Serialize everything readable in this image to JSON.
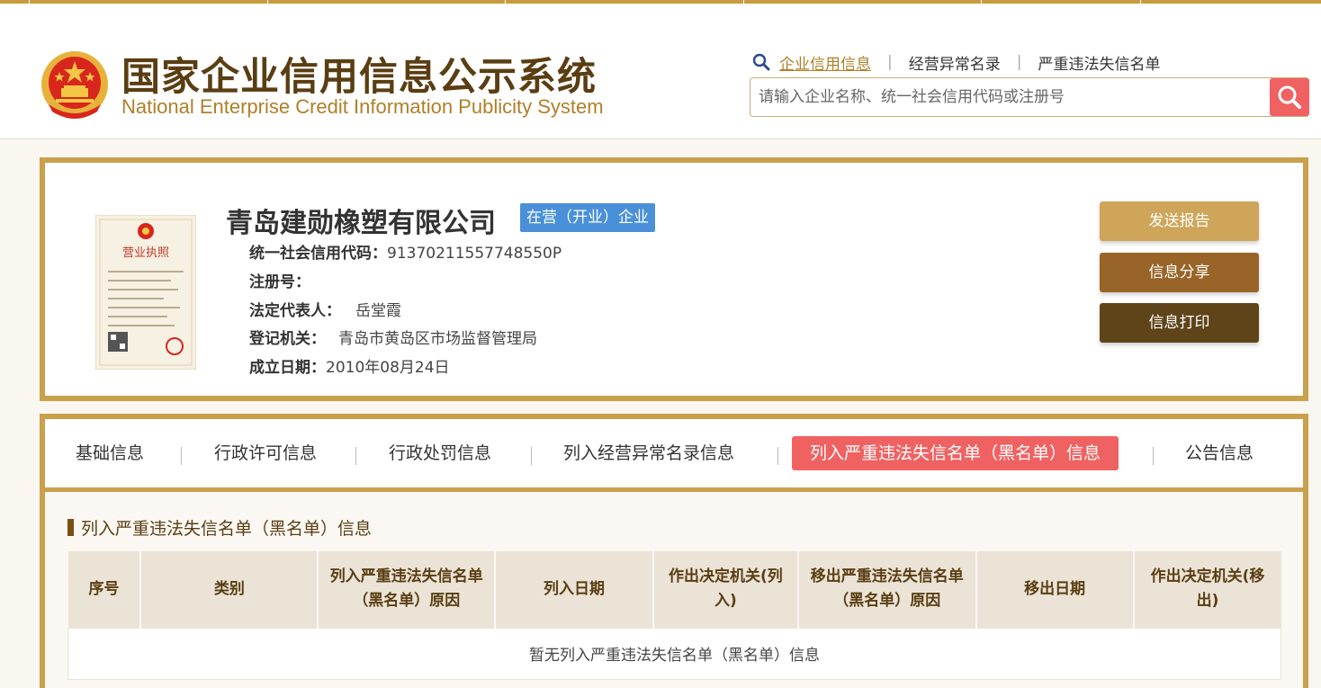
{
  "header": {
    "title_cn": "国家企业信用信息公示系统",
    "title_en": "National Enterprise Credit Information Publicity System",
    "search_links": [
      "企业信用信息",
      "经营异常名录",
      "严重违法失信名单"
    ],
    "search_placeholder": "请输入企业名称、统一社会信用代码或注册号",
    "icons": [
      "emblem-icon",
      "search-icon"
    ]
  },
  "company": {
    "name": "青岛建勋橡塑有限公司",
    "status": "在营（开业）企业",
    "fields": [
      {
        "label": "统一社会信用代码：",
        "value": "91370211557748550P"
      },
      {
        "label": "注册号：",
        "value": ""
      },
      {
        "label": "法定代表人：",
        "value": "岳堂霞"
      },
      {
        "label": "登记机关：",
        "value": "青岛市黄岛区市场监督管理局"
      },
      {
        "label": "成立日期：",
        "value": "2010年08月24日"
      }
    ],
    "license_title": "营业执照",
    "actions": [
      "发送报告",
      "信息分享",
      "信息打印"
    ],
    "colors": {
      "report": "#cfa559",
      "share": "#996427",
      "print": "#5e4418",
      "status": "#4a90d9"
    }
  },
  "tabs": [
    {
      "label": "基础信息",
      "active": false
    },
    {
      "label": "行政许可信息",
      "active": false
    },
    {
      "label": "行政处罚信息",
      "active": false
    },
    {
      "label": "列入经营异常名录信息",
      "active": false
    },
    {
      "label": "列入严重违法失信名单（黑名单）信息",
      "active": true
    },
    {
      "label": "公告信息",
      "active": false
    }
  ],
  "section": {
    "title": "列入严重违法失信名单（黑名单）信息",
    "columns": [
      "序号",
      "类别",
      "列入严重违法失信名单（黑名单）原因",
      "列入日期",
      "作出决定机关(列入)",
      "移出严重违法失信名单（黑名单）原因",
      "移出日期",
      "作出决定机关(移出)"
    ],
    "empty_text": "暂无列入严重违法失信名单（黑名单）信息"
  }
}
